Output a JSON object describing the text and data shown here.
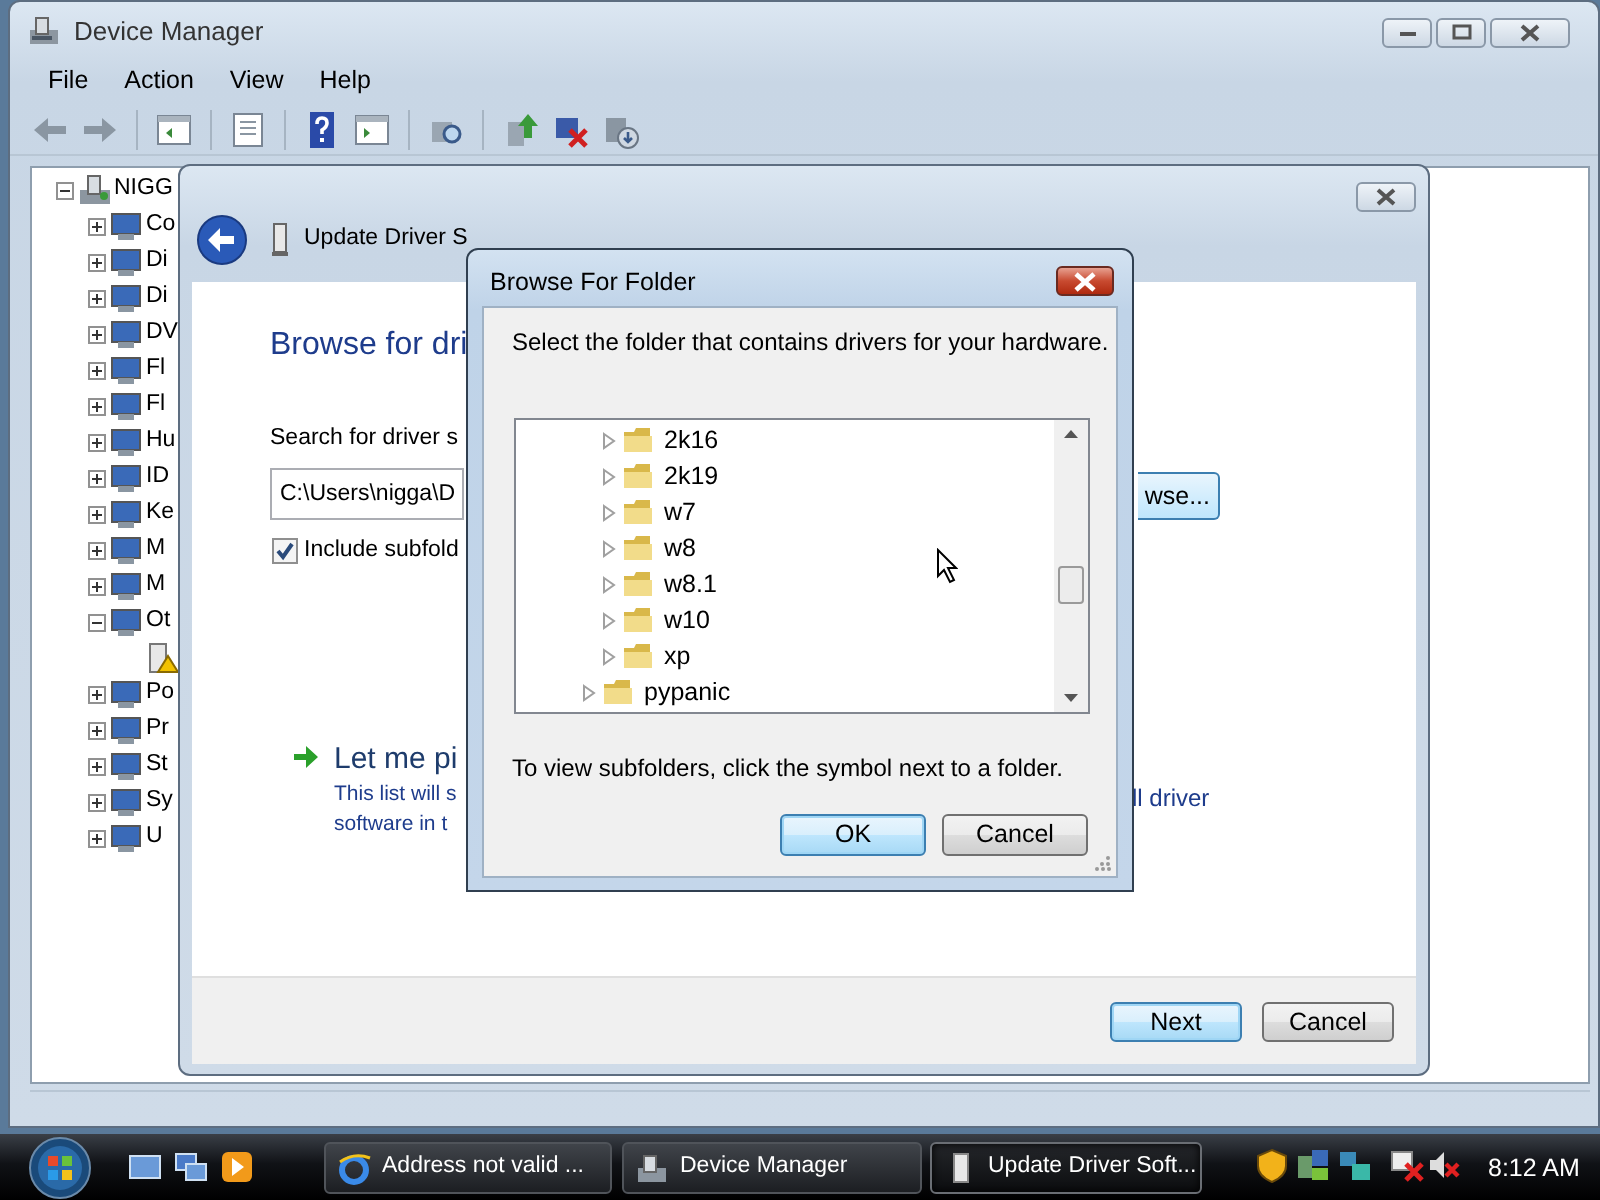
{
  "device_manager": {
    "title": "Device Manager",
    "menu": [
      "File",
      "Action",
      "View",
      "Help"
    ],
    "tree": {
      "label": "NIGG",
      "expanded": true,
      "children": [
        {
          "label": "Co",
          "expanded": false
        },
        {
          "label": "Di",
          "expanded": false
        },
        {
          "label": "Di",
          "expanded": false
        },
        {
          "label": "DV",
          "expanded": false
        },
        {
          "label": "Fl",
          "expanded": false
        },
        {
          "label": "Fl",
          "expanded": false
        },
        {
          "label": "Hu",
          "expanded": false
        },
        {
          "label": "ID",
          "expanded": false
        },
        {
          "label": "Ke",
          "expanded": false
        },
        {
          "label": "M",
          "expanded": false
        },
        {
          "label": "M",
          "expanded": false
        },
        {
          "label": "Ot",
          "expanded": true,
          "children": [
            {
              "warning": true
            }
          ]
        },
        {
          "label": "Po",
          "expanded": false
        },
        {
          "label": "Pr",
          "expanded": false
        },
        {
          "label": "St",
          "expanded": false
        },
        {
          "label": "Sy",
          "expanded": false
        },
        {
          "label": "U",
          "expanded": false
        }
      ]
    }
  },
  "update_driver": {
    "title": "Update Driver S",
    "heading": "Browse for dri",
    "search_label": "Search for driver s",
    "path": "C:\\Users\\nigga\\D",
    "browse_button": "wse...",
    "include_subfolders": {
      "label": "Include subfold",
      "checked": true
    },
    "pick": {
      "title": "Let me pi",
      "line1": "This list will s",
      "line1_end": "ll driver",
      "line2": "software in t"
    },
    "buttons": [
      {
        "label": "Next",
        "default": true
      },
      {
        "label": "Cancel",
        "default": false
      }
    ]
  },
  "browse_dialog": {
    "title": "Browse For Folder",
    "prompt": "Select the folder that contains drivers for your hardware.",
    "tree": [
      {
        "children": [
          {
            "label": "2k16"
          },
          {
            "label": "2k19"
          },
          {
            "label": "w7"
          },
          {
            "label": "w8"
          },
          {
            "label": "w8.1"
          },
          {
            "label": "w10"
          },
          {
            "label": "xp"
          }
        ]
      },
      {
        "label": "pypanic"
      }
    ],
    "hint": "To view subfolders, click the symbol next to a folder.",
    "buttons": [
      {
        "label": "OK",
        "default": true
      },
      {
        "label": "Cancel",
        "default": false
      }
    ]
  },
  "taskbar": {
    "tasks": [
      {
        "label": "Address not valid ...",
        "kind": "browser",
        "selected": false
      },
      {
        "label": "Device Manager",
        "kind": "device-manager",
        "selected": false
      },
      {
        "label": "Update Driver Soft...",
        "kind": "driver",
        "selected": true
      }
    ],
    "clock": "8:12 AM"
  }
}
